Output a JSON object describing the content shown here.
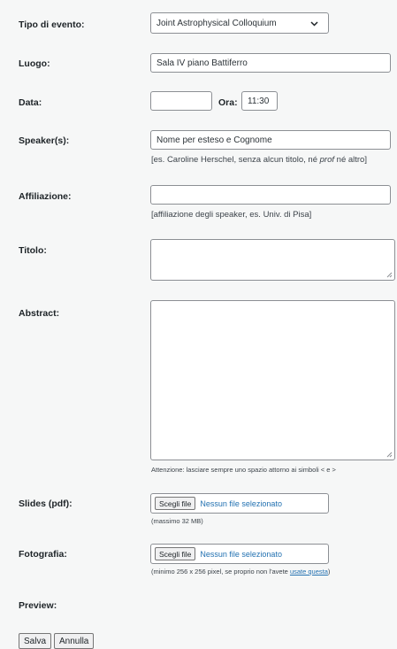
{
  "event_type": {
    "label": "Tipo di evento:",
    "selected": "Joint Astrophysical Colloquium"
  },
  "venue": {
    "label": "Luogo:",
    "value": "Sala IV piano Battiferro"
  },
  "date": {
    "label": "Data:",
    "value": "",
    "time_label": "Ora:",
    "time_value": "11:30"
  },
  "speakers": {
    "label": "Speaker(s):",
    "value": "Nome per esteso e Cognome",
    "hint_before": "[es. Caroline Herschel, senza alcun titolo, né ",
    "hint_em": "prof",
    "hint_after": " né altro]"
  },
  "affiliation": {
    "label": "Affiliazione:",
    "value": "",
    "hint": "[affiliazione degli speaker, es. Univ. di Pisa]"
  },
  "title": {
    "label": "Titolo:",
    "value": ""
  },
  "abstract": {
    "label": "Abstract:",
    "value": "",
    "hint": "Attenzione: lasciare sempre uno spazio attorno ai simboli < e >"
  },
  "slides": {
    "label": "Slides (pdf):",
    "button": "Scegli file",
    "status": "Nessun file selezionato",
    "hint": "(massimo 32 MB)"
  },
  "photo": {
    "label": "Fotografia:",
    "button": "Scegli file",
    "status": "Nessun file selezionato",
    "hint_before": "(minimo 256 x 256 pixel, se proprio non l'avete ",
    "hint_link": "usate questa",
    "hint_after": ")"
  },
  "preview": {
    "label": "Preview:"
  },
  "actions": {
    "save": "Salva",
    "cancel": "Annulla"
  },
  "colors": {
    "background": "#f6f7f7",
    "link": "#2271b1",
    "border": "#8c8f94"
  }
}
